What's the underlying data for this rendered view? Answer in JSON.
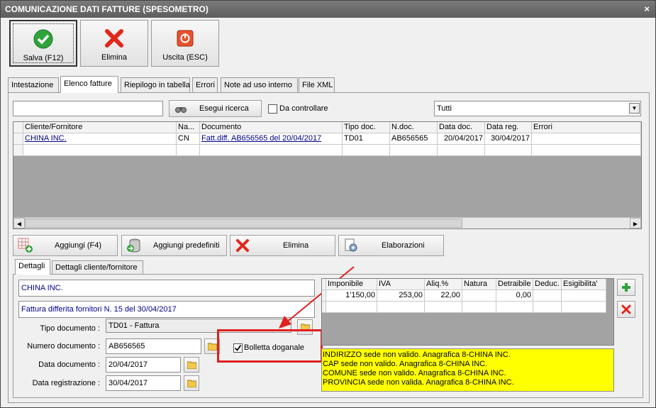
{
  "window": {
    "title": "COMUNICAZIONE DATI FATTURE (SPESOMETRO)",
    "close": "×"
  },
  "toolbar": {
    "save_label": "Salva (F12)",
    "delete_label": "Elimina",
    "exit_label": "Uscita (ESC)"
  },
  "tabs": [
    {
      "label": "Intestazione"
    },
    {
      "label": "Elenco fatture"
    },
    {
      "label": "Riepilogo in tabella"
    },
    {
      "label": "Errori"
    },
    {
      "label": "Note ad uso interno"
    },
    {
      "label": "File XML"
    }
  ],
  "search": {
    "value": "",
    "button_label": "Esegui ricerca",
    "to_check_label": "Da controllare",
    "filter_value": "Tutti"
  },
  "invoice_grid": {
    "columns": [
      "Cliente/Fornitore",
      "Na...",
      "Documento",
      "Tipo doc.",
      "N.doc.",
      "Data doc.",
      "Data reg.",
      "Errori"
    ],
    "rows": [
      {
        "cliente": "CHINA INC.",
        "na": "CN",
        "documento": "Fatt.diff. AB656565 del 20/04/2017",
        "tipo": "TD01",
        "ndoc": "AB656565",
        "data_doc": "20/04/2017",
        "data_reg": "30/04/2017",
        "errori": ""
      }
    ]
  },
  "actions": {
    "add": "Aggiungi (F4)",
    "add_predef": "Aggiungi predefiniti",
    "delete": "Elimina",
    "process": "Elaborazioni"
  },
  "subtabs": [
    {
      "label": "Dettagli"
    },
    {
      "label": "Dettagli cliente/fornitore"
    }
  ],
  "details": {
    "client_name": "CHINA INC.",
    "description": "Fattura differita fornitori N. 15 del 30/04/2017",
    "doc_type_label": "Tipo documento :",
    "doc_type_value": "TD01 - Fattura",
    "doc_number_label": "Numero documento :",
    "doc_number_value": "AB656565",
    "doc_date_label": "Data documento :",
    "doc_date_value": "20/04/2017",
    "reg_date_label": "Data registrazione :",
    "reg_date_value": "30/04/2017",
    "customs_label": "Bolletta doganale",
    "customs_checked": true
  },
  "vat_grid": {
    "columns": [
      "Imponibile",
      "IVA",
      "Aliq.%",
      "Natura",
      "Detraibile",
      "Deduc.",
      "Esigibilita'"
    ],
    "rows": [
      {
        "imponibile": "1'150,00",
        "iva": "253,00",
        "aliq": "22,00",
        "natura": "",
        "detraibile": "0,00",
        "deduc": "",
        "esig": ""
      }
    ]
  },
  "warnings": [
    "INDIRIZZO sede non valido. Anagrafica 8-CHINA INC.",
    "CAP sede non valido. Anagrafica 8-CHINA INC.",
    "COMUNE sede non valido. Anagrafica 8-CHINA INC.",
    "PROVINCIA sede non valida. Anagrafica 8-CHINA INC."
  ],
  "colors": {
    "annotation": "#e02020",
    "warning_bg": "#ffff00",
    "link": "#00008b"
  }
}
